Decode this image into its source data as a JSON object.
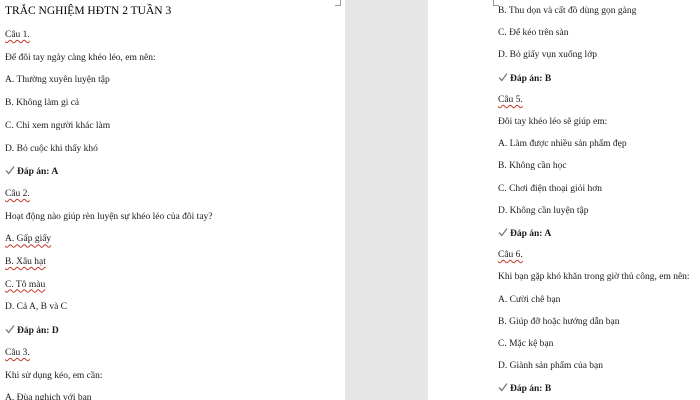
{
  "document": {
    "title": "TRẮC NGHIỆM HĐTN 2 TUẦN 3",
    "check_icon_color": "#7a7a7a",
    "underline_color": "#c0392b"
  },
  "left_page": {
    "lines": [
      {
        "text": "Câu 1.",
        "kind": "q"
      },
      {
        "text": "Để đôi tay ngày càng khéo léo, em nên:",
        "kind": "p"
      },
      {
        "text": "A. Thường xuyên luyện tập",
        "kind": "p"
      },
      {
        "text": "B. Không làm gì cả",
        "kind": "p"
      },
      {
        "text": "C. Chỉ xem người khác làm",
        "kind": "p"
      },
      {
        "text": "D. Bỏ cuộc khi thấy khó",
        "kind": "p"
      },
      {
        "text": "Đáp án: A",
        "kind": "a"
      },
      {
        "text": "Câu 2.",
        "kind": "q"
      },
      {
        "text": "Hoạt động nào giúp rèn luyện sự khéo léo của đôi tay?",
        "kind": "p"
      },
      {
        "text": "A. Gấp giấy",
        "kind": "s"
      },
      {
        "text": "B. Xâu hạt",
        "kind": "s"
      },
      {
        "text": "C. Tô màu",
        "kind": "s"
      },
      {
        "text": "D. Cả A, B và C",
        "kind": "p"
      },
      {
        "text": "Đáp án: D",
        "kind": "a"
      },
      {
        "text": "Câu 3.",
        "kind": "q"
      },
      {
        "text": "Khi sử dụng kéo, em cần:",
        "kind": "p"
      },
      {
        "text": "A. Đùa nghịch với bạn",
        "kind": "p"
      }
    ]
  },
  "right_page": {
    "lines": [
      {
        "text": "B. Thu dọn và cất đồ dùng gọn gàng",
        "kind": "p"
      },
      {
        "text": "C. Để kéo trên sàn",
        "kind": "p"
      },
      {
        "text": "D. Bỏ giấy vụn xuống lớp",
        "kind": "p"
      },
      {
        "text": "Đáp án: B",
        "kind": "a"
      },
      {
        "text": "Câu 5.",
        "kind": "q"
      },
      {
        "text": "Đôi tay khéo léo sẽ giúp em:",
        "kind": "p"
      },
      {
        "text": "A. Làm được nhiều sản phẩm đẹp",
        "kind": "p"
      },
      {
        "text": "B. Không cần học",
        "kind": "p"
      },
      {
        "text": "C. Chơi điện thoại giỏi hơn",
        "kind": "p"
      },
      {
        "text": "D. Không cần luyện tập",
        "kind": "p"
      },
      {
        "text": "Đáp án: A",
        "kind": "a"
      },
      {
        "text": "Câu 6.",
        "kind": "q"
      },
      {
        "text": "Khi bạn gặp khó khăn trong giờ thủ công, em nên:",
        "kind": "p"
      },
      {
        "text": "A. Cười chê bạn",
        "kind": "p"
      },
      {
        "text": "B. Giúp đỡ hoặc hướng dẫn bạn",
        "kind": "p"
      },
      {
        "text": "C. Mặc kệ bạn",
        "kind": "p"
      },
      {
        "text": "D. Giành sản phẩm của bạn",
        "kind": "p"
      },
      {
        "text": "Đáp án: B",
        "kind": "a"
      }
    ]
  }
}
